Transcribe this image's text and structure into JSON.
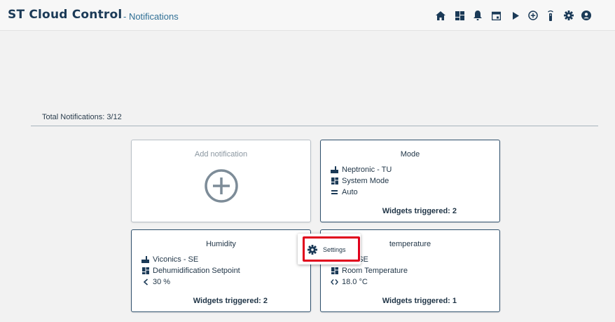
{
  "header": {
    "app_title": "ST Cloud Control",
    "section": "- Notifications",
    "nav_icons": [
      "home-icon",
      "dashboard-icon",
      "bell-icon",
      "calendar-icon",
      "play-icon",
      "add-circle-icon",
      "remote-icon",
      "gear-icon",
      "account-icon"
    ]
  },
  "summary": {
    "total_label": "Total Notifications: 3/12"
  },
  "add_card": {
    "label": "Add notification"
  },
  "cards": [
    {
      "title": "Mode",
      "device": "Neptronic - TU",
      "point": "System Mode",
      "condition": "Auto",
      "triggered": "Widgets triggered: 2"
    },
    {
      "title": "Humidity",
      "device": "Viconics - SE",
      "point": "Dehumidification Setpoint",
      "condition": "30 %",
      "triggered": "Widgets triggered: 2"
    },
    {
      "title": "temperature",
      "device": "ics - SE",
      "point": "Room Temperature",
      "condition": "18.0 °C",
      "triggered": "Widgets triggered: 1"
    }
  ],
  "context_menu": {
    "item_label": "Settings"
  },
  "colors": {
    "brand": "#1b3a57",
    "accent": "#2f6f95",
    "highlight": "#e0001b"
  }
}
